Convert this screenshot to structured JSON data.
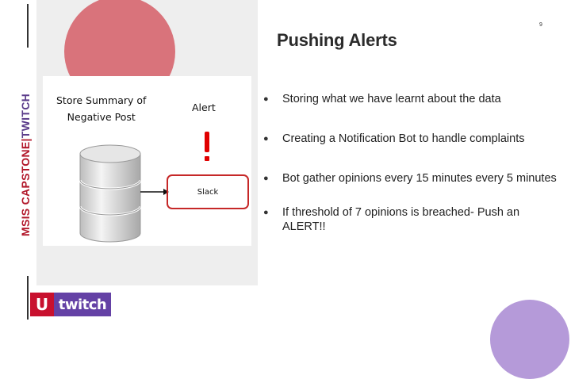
{
  "slide": {
    "page_number": "9",
    "title": "Pushing Alerts",
    "side_label": {
      "main": "MSIS CAPSTONE",
      "separator": "|",
      "brand": "TWITCH"
    }
  },
  "diagram": {
    "summary_line1": "Store Summary of",
    "summary_line2": "Negative Post",
    "alert_label": "Alert",
    "slack_label": "Slack"
  },
  "bullets": [
    "Storing what we have learnt about the data",
    "Creating a Notification Bot to handle complaints",
    "Bot gather opinions every 15 minutes every 5 minutes",
    "If threshold of 7 opinions is breached- Push an ALERT!!"
  ],
  "logo": {
    "u_mark": "U",
    "brand_text": "twitch"
  },
  "colors": {
    "accent_red": "#b2182b",
    "accent_purple": "#6441a5",
    "deco_pink": "#d9737b",
    "deco_lavender": "#b59ad9"
  }
}
